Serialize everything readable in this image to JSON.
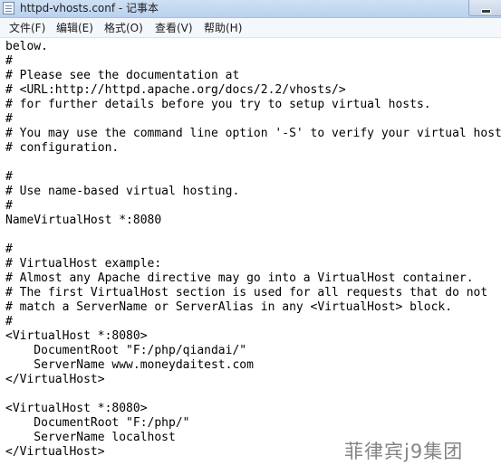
{
  "window": {
    "title": "httpd-vhosts.conf - 记事本"
  },
  "menu": {
    "items": [
      "文件(F)",
      "编辑(E)",
      "格式(O)",
      "查看(V)",
      "帮助(H)"
    ]
  },
  "editor": {
    "lines": [
      "below.",
      "#",
      "# Please see the documentation at",
      "# <URL:http://httpd.apache.org/docs/2.2/vhosts/>",
      "# for further details before you try to setup virtual hosts.",
      "#",
      "# You may use the command line option '-S' to verify your virtual host",
      "# configuration.",
      "",
      "#",
      "# Use name-based virtual hosting.",
      "#",
      "NameVirtualHost *:8080",
      "",
      "#",
      "# VirtualHost example:",
      "# Almost any Apache directive may go into a VirtualHost container.",
      "# The first VirtualHost section is used for all requests that do not",
      "# match a ServerName or ServerAlias in any <VirtualHost> block.",
      "#",
      "<VirtualHost *:8080>",
      "    DocumentRoot \"F:/php/qiandai/\"",
      "    ServerName www.moneydaitest.com",
      "</VirtualHost>",
      "",
      "<VirtualHost *:8080>",
      "    DocumentRoot \"F:/php/\"",
      "    ServerName localhost",
      "</VirtualHost>"
    ]
  },
  "watermark": {
    "text": "菲律宾j9集团"
  }
}
